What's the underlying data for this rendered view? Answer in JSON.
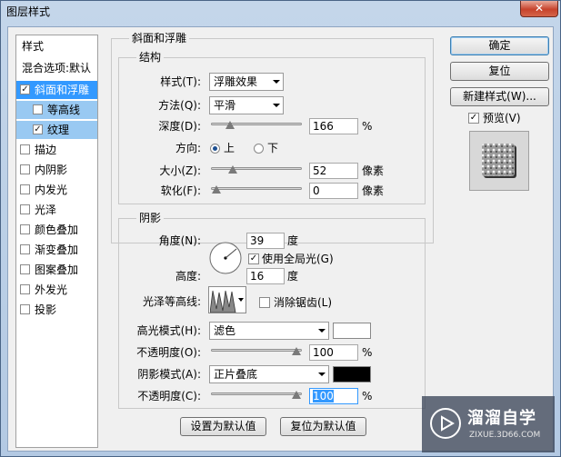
{
  "window": {
    "title": "图层样式",
    "close_icon": "✕"
  },
  "styles_list": {
    "header": "样式",
    "blend_options": "混合选项:默认",
    "items": [
      {
        "label": "斜面和浮雕",
        "checked": true
      },
      {
        "label": "等高线",
        "checked": false
      },
      {
        "label": "纹理",
        "checked": true
      },
      {
        "label": "描边",
        "checked": false
      },
      {
        "label": "内阴影",
        "checked": false
      },
      {
        "label": "内发光",
        "checked": false
      },
      {
        "label": "光泽",
        "checked": false
      },
      {
        "label": "颜色叠加",
        "checked": false
      },
      {
        "label": "渐变叠加",
        "checked": false
      },
      {
        "label": "图案叠加",
        "checked": false
      },
      {
        "label": "外发光",
        "checked": false
      },
      {
        "label": "投影",
        "checked": false
      }
    ]
  },
  "bevel": {
    "section_title": "斜面和浮雕",
    "structure": {
      "title": "结构",
      "style_label": "样式(T):",
      "style_value": "浮雕效果",
      "technique_label": "方法(Q):",
      "technique_value": "平滑",
      "depth_label": "深度(D):",
      "depth_value": "166",
      "depth_unit": "%",
      "depth_level": 0.166,
      "direction_label": "方向:",
      "direction_up": "上",
      "direction_down": "下",
      "direction_selected": "上",
      "size_label": "大小(Z):",
      "size_value": "52",
      "size_unit": "像素",
      "size_level": 0.21,
      "soften_label": "软化(F):",
      "soften_value": "0",
      "soften_unit": "像素",
      "soften_level": 0.0
    },
    "shading": {
      "title": "阴影",
      "angle_label": "角度(N):",
      "angle_value": "39",
      "angle_unit": "度",
      "global_light_label": "使用全局光(G)",
      "global_light_checked": true,
      "altitude_label": "高度:",
      "altitude_value": "16",
      "altitude_unit": "度",
      "gloss_contour_label": "光泽等高线:",
      "anti_alias_label": "消除锯齿(L)",
      "anti_alias_checked": false,
      "highlight_mode_label": "高光模式(H):",
      "highlight_mode_value": "滤色",
      "highlight_color": "#ffffff",
      "highlight_opacity_label": "不透明度(O):",
      "highlight_opacity_value": "100",
      "highlight_opacity_unit": "%",
      "shadow_mode_label": "阴影模式(A):",
      "shadow_mode_value": "正片叠底",
      "shadow_color": "#000000",
      "shadow_opacity_label": "不透明度(C):",
      "shadow_opacity_value": "100",
      "shadow_opacity_unit": "%"
    },
    "make_default": "设置为默认值",
    "reset_default": "复位为默认值"
  },
  "side": {
    "ok": "确定",
    "reset": "复位",
    "new_style": "新建样式(W)...",
    "preview_label": "预览(V)",
    "preview_checked": true
  },
  "watermark": {
    "brand": "溜溜自学",
    "url": "ZIXUE.3D66.COM"
  }
}
